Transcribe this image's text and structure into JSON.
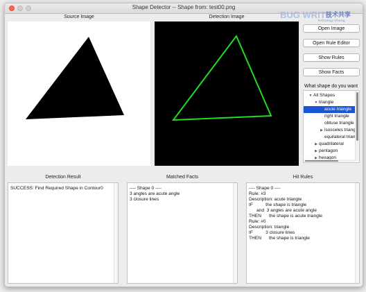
{
  "window": {
    "title": "Shape Detector -- Shape from: test00.png"
  },
  "panels": {
    "source_label": "Source Image",
    "detection_label": "Detection Image"
  },
  "buttons": {
    "open_image": "Open Image",
    "open_rule_editor": "Open Rule Editor",
    "show_rules": "Show Rules",
    "show_facts": "Show Facts"
  },
  "question": "What shape do you want",
  "tree": [
    {
      "label": "All Shapes",
      "arrow": "▼",
      "level": 0,
      "selected": false
    },
    {
      "label": "triangle",
      "arrow": "▼",
      "level": 1,
      "selected": false
    },
    {
      "label": "acute triangle",
      "arrow": "",
      "level": 2,
      "selected": true
    },
    {
      "label": "right triangle",
      "arrow": "",
      "level": 2,
      "selected": false
    },
    {
      "label": "obtuse triangle",
      "arrow": "",
      "level": 2,
      "selected": false
    },
    {
      "label": "isosceles triangle",
      "arrow": "▶",
      "level": 2,
      "selected": false
    },
    {
      "label": "equilateral triangle",
      "arrow": "",
      "level": 2,
      "selected": false
    },
    {
      "label": "quadrilateral",
      "arrow": "▶",
      "level": 1,
      "selected": false
    },
    {
      "label": "pentagon",
      "arrow": "▶",
      "level": 1,
      "selected": false
    },
    {
      "label": "hexagon",
      "arrow": "▶",
      "level": 1,
      "selected": false
    }
  ],
  "sections": {
    "detection_result": "Detection Result",
    "matched_facts": "Matched Facts",
    "hit_rules": "Hit Rules"
  },
  "detection_result_lines": [
    "SUCCESS: Find Required Shape in Contour0"
  ],
  "matched_facts_lines": [
    "---- Shape 0 ----",
    "3 angles are acute angle",
    "3 closure lines"
  ],
  "hit_rules_lines": [
    "---- Shape 0 ----",
    "Rule: #3",
    "Description: acute triangle",
    "IF          the shape is triangle",
    "      and  3 angles are acute angle",
    "THEN      the shape is acute triangle",
    "Rule: #0",
    "Description: triangle",
    "IF          3 closure lines",
    "THEN      the shape is triangle"
  ],
  "watermark": {
    "logo": "BUG WRITE",
    "text": "技术共享",
    "sub": "Technology Sharing"
  },
  "colors": {
    "selection": "#1a55d6",
    "detected_outline": "#22dd22",
    "close_button": "#fc615d"
  }
}
